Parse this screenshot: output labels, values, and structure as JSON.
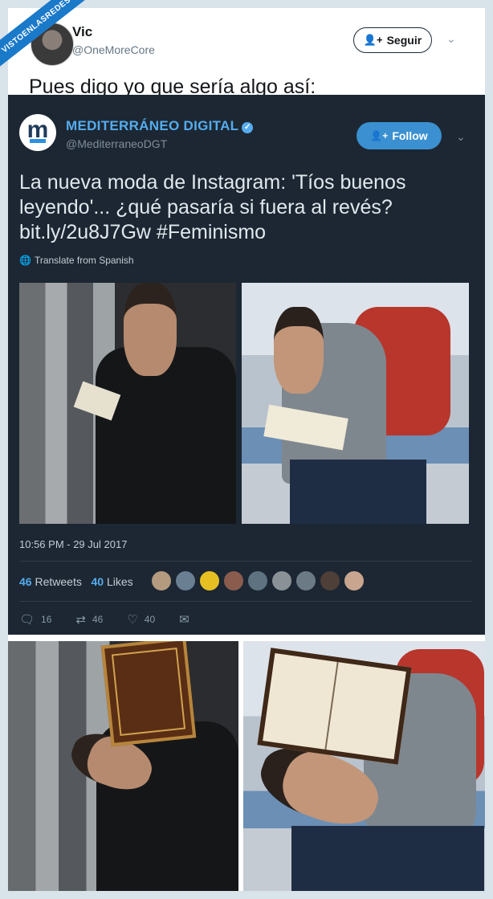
{
  "watermark": "VISTOENLASREDES",
  "outer_tweet": {
    "name": "Vic",
    "handle": "@OneMoreCore",
    "follow_label": "Seguir",
    "text": "Pues digo yo que sería algo así:"
  },
  "embedded_tweet": {
    "name": "MEDITERRÁNEO DIGITAL",
    "handle": "@MediterraneoDGT",
    "follow_label": "Follow",
    "text": "La nueva moda de Instagram: 'Tíos buenos leyendo'... ¿qué pasaría si fuera al revés? bit.ly/2u8J7Gw #Feminismo",
    "translate_label": "Translate from Spanish",
    "timestamp": "10:56 PM - 29 Jul 2017",
    "retweets_count": "46",
    "retweets_label": "Retweets",
    "likes_count": "40",
    "likes_label": "Likes",
    "reply_count": "16",
    "retweet_action_count": "46",
    "like_action_count": "40"
  },
  "icons": {
    "follow": "person-plus-icon",
    "verified": "verified-badge-icon",
    "translate": "globe-icon",
    "reply": "reply-icon",
    "retweet": "retweet-icon",
    "like": "heart-icon",
    "dm": "envelope-icon",
    "more": "chevron-down-icon"
  },
  "colors": {
    "twitter_blue": "#55acee",
    "dark_bg": "#1c2733",
    "follow_button": "#3a90d0",
    "watermark": "#1b79c9"
  }
}
